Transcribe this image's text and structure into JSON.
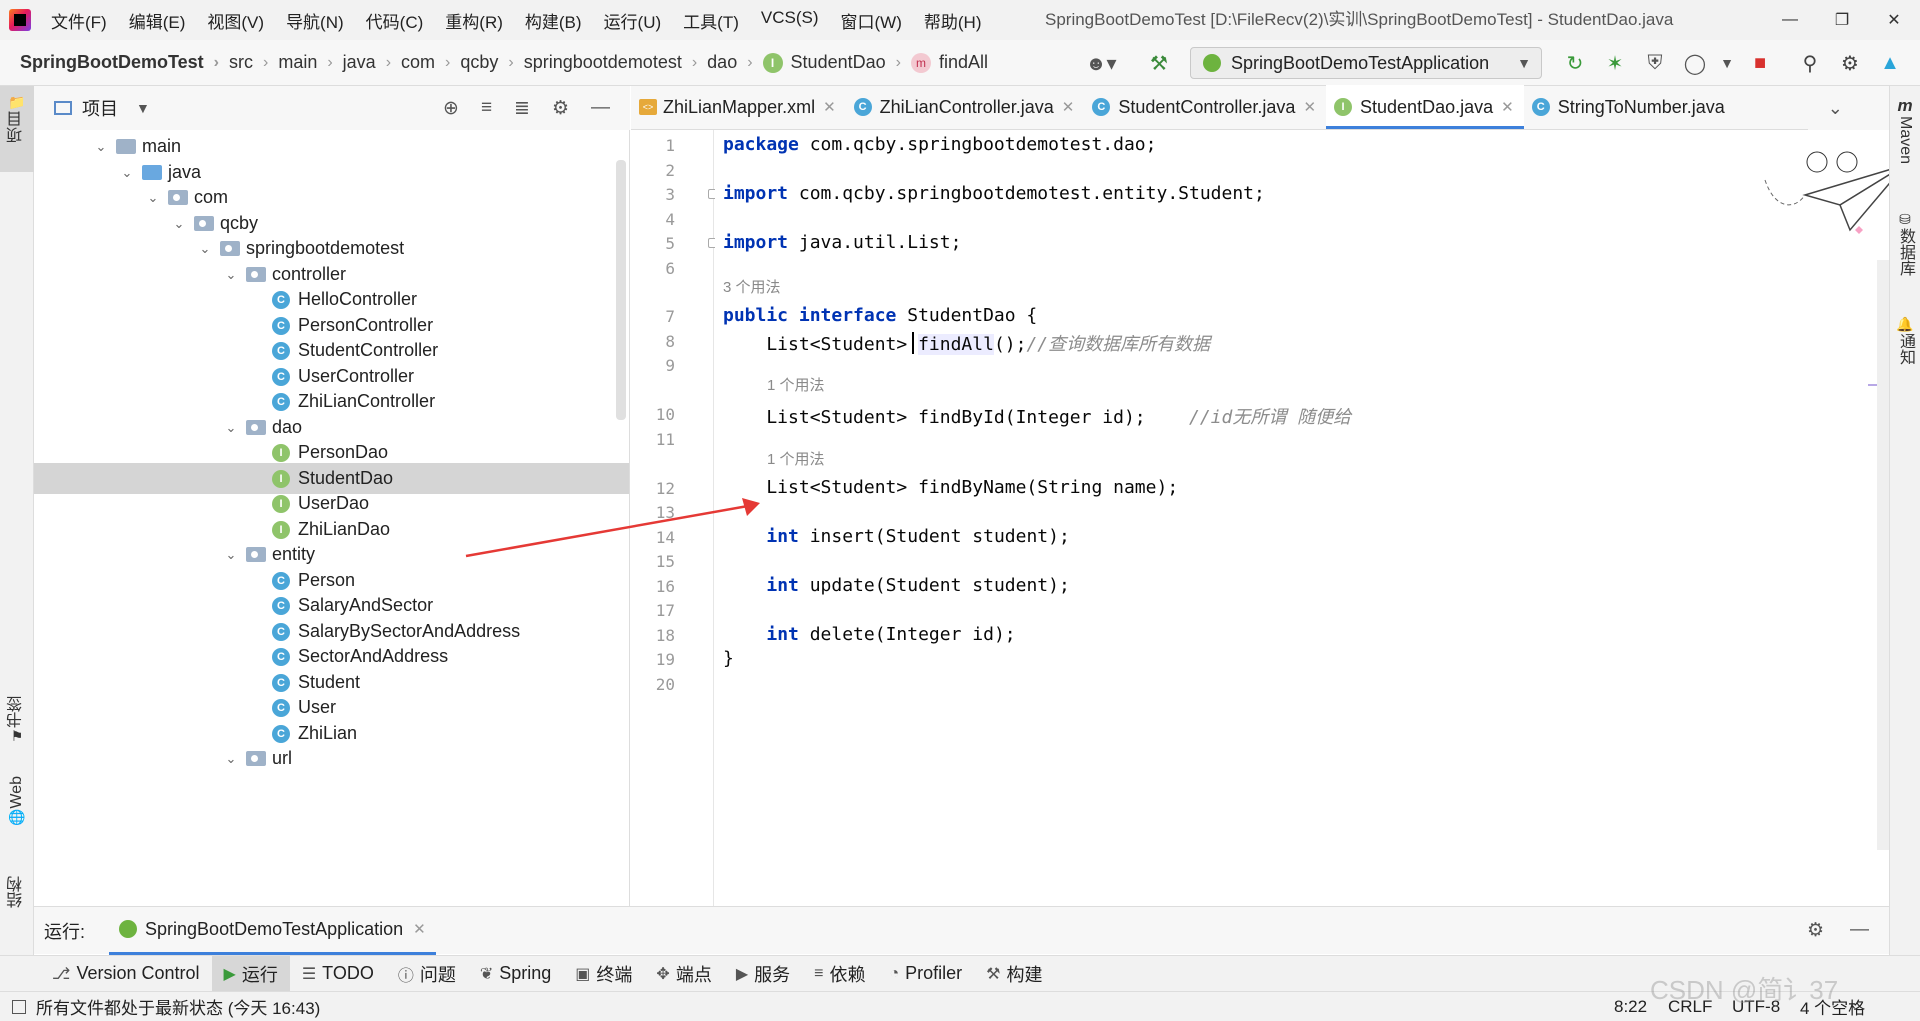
{
  "window": {
    "title": "SpringBootDemoTest [D:\\FileRecv(2)\\实训\\SpringBootDemoTest] - StudentDao.java",
    "menu": [
      "文件(F)",
      "编辑(E)",
      "视图(V)",
      "导航(N)",
      "代码(C)",
      "重构(R)",
      "构建(B)",
      "运行(U)",
      "工具(T)",
      "VCS(S)",
      "窗口(W)",
      "帮助(H)"
    ]
  },
  "breadcrumb": {
    "items": [
      "SpringBootDemoTest",
      "src",
      "main",
      "java",
      "com",
      "qcby",
      "springbootdemotest",
      "dao",
      "StudentDao",
      "findAll"
    ],
    "icons": {
      "StudentDao": "interface-icon",
      "findAll": "method-icon"
    }
  },
  "run_config": {
    "label": "SpringBootDemoTestApplication"
  },
  "left_strip": {
    "project": "项目",
    "bookmarks": "书签",
    "web": "Web",
    "structure": "结构"
  },
  "right_strip": {
    "maven": "Maven",
    "database": "数据库",
    "notifications": "通知"
  },
  "project_panel": {
    "title": "项目",
    "tree": [
      {
        "label": "main",
        "depth": 0,
        "kind": "folder",
        "expanded": true
      },
      {
        "label": "java",
        "depth": 1,
        "kind": "folder-blue",
        "expanded": true
      },
      {
        "label": "com",
        "depth": 2,
        "kind": "package",
        "expanded": true
      },
      {
        "label": "qcby",
        "depth": 3,
        "kind": "package",
        "expanded": true
      },
      {
        "label": "springbootdemotest",
        "depth": 4,
        "kind": "package",
        "expanded": true
      },
      {
        "label": "controller",
        "depth": 5,
        "kind": "package",
        "expanded": true
      },
      {
        "label": "HelloController",
        "depth": 6,
        "kind": "class"
      },
      {
        "label": "PersonController",
        "depth": 6,
        "kind": "class"
      },
      {
        "label": "StudentController",
        "depth": 6,
        "kind": "class"
      },
      {
        "label": "UserController",
        "depth": 6,
        "kind": "class"
      },
      {
        "label": "ZhiLianController",
        "depth": 6,
        "kind": "class"
      },
      {
        "label": "dao",
        "depth": 5,
        "kind": "package",
        "expanded": true
      },
      {
        "label": "PersonDao",
        "depth": 6,
        "kind": "interface"
      },
      {
        "label": "StudentDao",
        "depth": 6,
        "kind": "interface",
        "selected": true
      },
      {
        "label": "UserDao",
        "depth": 6,
        "kind": "interface"
      },
      {
        "label": "ZhiLianDao",
        "depth": 6,
        "kind": "interface"
      },
      {
        "label": "entity",
        "depth": 5,
        "kind": "package",
        "expanded": true
      },
      {
        "label": "Person",
        "depth": 6,
        "kind": "class"
      },
      {
        "label": "SalaryAndSector",
        "depth": 6,
        "kind": "class"
      },
      {
        "label": "SalaryBySectorAndAddress",
        "depth": 6,
        "kind": "class"
      },
      {
        "label": "SectorAndAddress",
        "depth": 6,
        "kind": "class"
      },
      {
        "label": "Student",
        "depth": 6,
        "kind": "class"
      },
      {
        "label": "User",
        "depth": 6,
        "kind": "class"
      },
      {
        "label": "ZhiLian",
        "depth": 6,
        "kind": "class"
      },
      {
        "label": "url",
        "depth": 5,
        "kind": "package",
        "expanded": true
      }
    ]
  },
  "editor_tabs": [
    {
      "label": "ZhiLianMapper.xml",
      "kind": "xml"
    },
    {
      "label": "ZhiLianController.java",
      "kind": "class"
    },
    {
      "label": "StudentController.java",
      "kind": "class"
    },
    {
      "label": "StudentDao.java",
      "kind": "interface",
      "active": true
    },
    {
      "label": "StringToNumber.java",
      "kind": "class"
    }
  ],
  "editor": {
    "line_numbers": [
      "1",
      "2",
      "3",
      "4",
      "5",
      "6",
      "7",
      "8",
      "9",
      "10",
      "11",
      "12",
      "13",
      "14",
      "15",
      "16",
      "17",
      "18",
      "19",
      "20"
    ],
    "code": {
      "l1_kw": "package",
      "l1_rest": " com.qcby.springbootdemotest.dao;",
      "l3_kw": "import",
      "l3_rest": " com.qcby.springbootdemotest.entity.Student;",
      "l5_kw": "import",
      "l5_rest": " java.util.List;",
      "hint7": "3 个用法",
      "l7_kw": "public interface",
      "l7_rest": " StudentDao {",
      "l8_pre": "    List<Student> ",
      "l8_name": "findAll",
      "l8_post": "();",
      "l8_cm": "//查询数据库所有数据",
      "hint10": "1 个用法",
      "l10_code": "    List<Student> findById(Integer id);    ",
      "l10_cm": "//id无所谓 随便给",
      "hint12": "1 个用法",
      "l12_code": "    List<Student> findByName(String name);",
      "l14_kw": "int",
      "l14_rest": " insert(Student student);",
      "l16_kw": "int",
      "l16_rest": " update(Student student);",
      "l18_kw": "int",
      "l18_rest": " delete(Integer id);",
      "l19": "}"
    }
  },
  "run_bar": {
    "label": "运行:",
    "config": "SpringBootDemoTestApplication"
  },
  "tool_windows": [
    "Version Control",
    "运行",
    "TODO",
    "问题",
    "Spring",
    "终端",
    "端点",
    "服务",
    "依赖",
    "Profiler",
    "构建"
  ],
  "status": {
    "message": "所有文件都处于最新状态 (今天 16:43)",
    "position": "8:22",
    "line_sep": "CRLF",
    "encoding": "UTF-8",
    "indent": "4 个空格",
    "watermark": "CSDN @简讠37"
  },
  "colors": {
    "keyword": "#0033b3",
    "comment": "#8c8c8c",
    "accent": "#3d80db",
    "arrow": "#e53935"
  }
}
